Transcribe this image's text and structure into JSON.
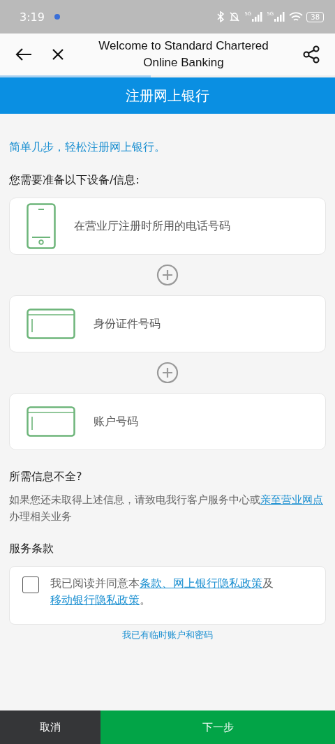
{
  "status_bar": {
    "time": "3:19",
    "signal_1": "5G",
    "signal_2": "5G",
    "battery": "38"
  },
  "header": {
    "title": "Welcome to Standard Chartered Online Banking",
    "progress": {
      "level": 0.45
    }
  },
  "banner": {
    "title": "注册网上银行"
  },
  "tagline": "简单几步，轻松注册网上银行。",
  "requirements_heading": "您需要准备以下设备/信息:",
  "requirements": [
    {
      "kind": "phone",
      "label": "在营业厅注册时所用的电话号码"
    },
    {
      "kind": "card",
      "label": "身份证件号码"
    },
    {
      "kind": "card",
      "label": "账户号码"
    }
  ],
  "missing_info": {
    "heading": "所需信息不全?",
    "segments": [
      {
        "kind": "text",
        "text": "如果您还未取得上述信息，请致电我行客户服务中心或"
      },
      {
        "kind": "link",
        "text": "亲至营业网点"
      },
      {
        "kind": "text",
        "text": "办理相关业务"
      }
    ]
  },
  "terms": {
    "heading": "服务条款",
    "checked": false,
    "segments": [
      {
        "kind": "text",
        "text": "我已阅读并同意本"
      },
      {
        "kind": "link",
        "text": "条款、网上银行隐私政策"
      },
      {
        "kind": "text",
        "text": "及"
      },
      {
        "kind": "link",
        "text": "移动银行隐私政策"
      },
      {
        "kind": "text",
        "text": "。"
      }
    ]
  },
  "temp_account_link": "我已有临时账户和密码",
  "buttons": {
    "cancel": "取消",
    "next": "下一步"
  }
}
